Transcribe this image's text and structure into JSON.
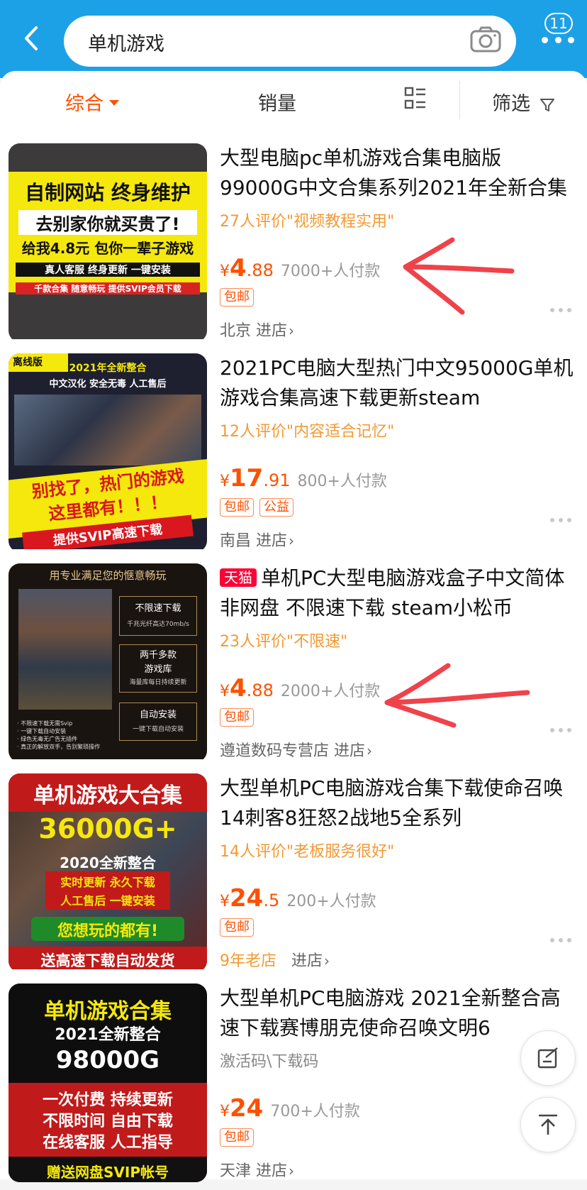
{
  "header": {
    "search_query": "单机游戏",
    "message_count": "11"
  },
  "sortbar": {
    "tabs": [
      {
        "label": "综合",
        "active": true
      },
      {
        "label": "销量",
        "active": false
      },
      {
        "label": "筛选",
        "active": false
      }
    ]
  },
  "products": [
    {
      "title": "大型电脑pc单机游戏合集电脑版99000G中文合集系列2021年全新合集",
      "tmall": "",
      "review": "27人评价\"视频教程实用\"",
      "price_int": "4",
      "price_dec": ".88",
      "sales": "7000+人付款",
      "tags": [
        "包邮"
      ],
      "store_prefix": "",
      "store": "北京",
      "enter": "进店",
      "thumb_text": [
        "自制网站 终身维护",
        "去别家你就买贵了!",
        "给我4.8元 包你一辈子游戏",
        "真人客服  终身更新  一键安装",
        "千款合集 随意畅玩 提供SVIP会员下载"
      ]
    },
    {
      "title": "2021PC电脑大型热门中文95000G单机游戏合集高速下载更新steam",
      "tmall": "",
      "review": "12人评价\"内容适合记忆\"",
      "price_int": "17",
      "price_dec": ".91",
      "sales": "800+人付款",
      "tags": [
        "包邮",
        "公益"
      ],
      "store_prefix": "",
      "store": "南昌",
      "enter": "进店",
      "thumb_text": [
        "离线版",
        "2021年全新整合",
        "中文汉化  安全无毒  人工售后",
        "别找了，热门的游戏",
        "这里都有！！！",
        "提供SVIP高速下载"
      ]
    },
    {
      "title": "单机PC大型电脑游戏盒子中文简体 非网盘 不限速下载 steam小松币",
      "tmall": "天猫",
      "review": "23人评价\"不限速\"",
      "price_int": "4",
      "price_dec": ".88",
      "sales": "2000+人付款",
      "tags": [
        "包邮"
      ],
      "store_prefix": "",
      "store": "遵道数码专营店",
      "enter": "进店",
      "thumb_text": [
        "用专业满足您的惬意畅玩",
        "不限速下载",
        "千兆光纤高达70mb/s",
        "两千多款",
        "游戏库",
        "海量库每日持续更新",
        "自动安装",
        "一键下载自动安装",
        "· 不限速下载无需Svip",
        "· 一键下载自动安装",
        "· 绿色无毒无广告无插件",
        "· 真正的解放双手，告别繁琐操作"
      ]
    },
    {
      "title": "大型单机PC电脑游戏合集下载使命召唤14刺客8狂怒2战地5全系列",
      "tmall": "",
      "review": "14人评价\"老板服务很好\"",
      "price_int": "24",
      "price_dec": ".5",
      "sales": "200+人付款",
      "tags": [
        "包邮"
      ],
      "store_prefix": "9年老店",
      "store": "",
      "enter": "进店",
      "thumb_text": [
        "单机游戏大合集",
        "36000G+",
        "2020全新整合",
        "实时更新 永久下载",
        "人工售后 一键安装",
        "您想玩的都有!",
        "送高速下载自动发货"
      ]
    },
    {
      "title": "大型单机PC电脑游戏 2021全新整合高速下载赛博朋克使命召唤文明6",
      "tmall": "",
      "review": "激活码\\下载码",
      "price_int": "24",
      "price_dec": "",
      "sales": "700+人付款",
      "tags": [
        "包邮"
      ],
      "store_prefix": "",
      "store": "天津",
      "enter": "进店",
      "thumb_text": [
        "单机游戏合集",
        "2021全新整合",
        "98000G",
        "一次付费  持续更新",
        "不限时间  自由下载",
        "在线客服  人工指导",
        "赠送网盘SVIP帐号"
      ]
    }
  ],
  "colors": {
    "header": "#1da1e6",
    "accent": "#ff5000",
    "review": "#f29a34",
    "annotation": "#f0424a"
  }
}
